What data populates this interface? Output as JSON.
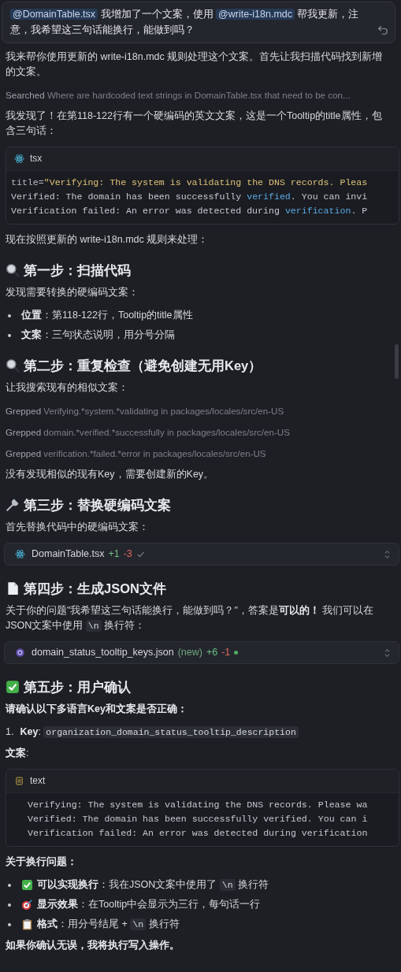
{
  "user_message": {
    "segments": [
      {
        "text": "@DomainTable.tsx",
        "kind": "mention"
      },
      {
        "text": " 我增加了一个文案，使用 ",
        "kind": "plain"
      },
      {
        "text": "@write-i18n.mdc",
        "kind": "mention"
      },
      {
        "text": " 帮我更新，注意，我希望这三句话能换行，能做到吗？",
        "kind": "plain"
      }
    ]
  },
  "blocks": [
    {
      "kind": "paragraph",
      "segments": [
        {
          "text": "我来帮你使用更新的 write-i18n.mdc 规则处理这个文案。首先让我扫描代码找到新增的文案。",
          "kind": "plain"
        }
      ]
    },
    {
      "kind": "tool",
      "verb": "Searched",
      "detail": "Where are hardcoded text strings in DomainTable.tsx that need to be con..."
    },
    {
      "kind": "paragraph",
      "segments": [
        {
          "text": "我发现了！在第118-122行有一个硬编码的英文文案，这是一个Tooltip的title属性，包含三句话：",
          "kind": "plain"
        }
      ]
    },
    {
      "kind": "code",
      "lang": "tsx",
      "lines": [
        [
          {
            "text": "title=",
            "kind": "attr"
          },
          {
            "text": "\"Verifying: The system is validating the DNS records. Pleas",
            "kind": "string"
          }
        ],
        [
          {
            "text": "Verified: The domain has been successfully ",
            "kind": "plain"
          },
          {
            "text": "verified",
            "kind": "link"
          },
          {
            "text": ". You can invi",
            "kind": "plain"
          }
        ],
        [
          {
            "text": "Verification failed: An error was detected during ",
            "kind": "plain"
          },
          {
            "text": "verification",
            "kind": "link"
          },
          {
            "text": ". P",
            "kind": "plain"
          }
        ]
      ]
    },
    {
      "kind": "paragraph",
      "segments": [
        {
          "text": "现在按照更新的 write-i18n.mdc 规则来处理：",
          "kind": "plain"
        }
      ]
    },
    {
      "kind": "heading",
      "text": "第一步：扫描代码"
    },
    {
      "kind": "paragraph",
      "segments": [
        {
          "text": "发现需要转换的硬编码文案：",
          "kind": "plain"
        }
      ]
    },
    {
      "kind": "list",
      "items": [
        {
          "kind": "plain",
          "segments": [
            {
              "text": "位置",
              "kind": "bold"
            },
            {
              "text": "：第118-122行，Tooltip的title属性",
              "kind": "plain"
            }
          ]
        },
        {
          "kind": "plain",
          "segments": [
            {
              "text": "文案",
              "kind": "bold"
            },
            {
              "text": "：三句状态说明，用分号分隔",
              "kind": "plain"
            }
          ]
        }
      ]
    },
    {
      "kind": "heading",
      "text": "第二步：重复检查（避免创建无用Key）"
    },
    {
      "kind": "paragraph",
      "segments": [
        {
          "text": "让我搜索现有的相似文案：",
          "kind": "plain"
        }
      ]
    },
    {
      "kind": "tool",
      "verb": "Grepped",
      "detail": "Verifying.*system.*validating in packages/locales/src/en-US"
    },
    {
      "kind": "tool",
      "verb": "Grepped",
      "detail": "domain.*verified.*successfully in packages/locales/src/en-US"
    },
    {
      "kind": "tool",
      "verb": "Grepped",
      "detail": "verification.*failed.*error in packages/locales/src/en-US"
    },
    {
      "kind": "paragraph",
      "segments": [
        {
          "text": "没有发现相似的现有Key，需要创建新的Key。",
          "kind": "plain"
        }
      ]
    },
    {
      "kind": "heading",
      "text": "第三步：替换硬编码文案"
    },
    {
      "kind": "paragraph",
      "segments": [
        {
          "text": "首先替换代码中的硬编码文案：",
          "kind": "plain"
        }
      ]
    },
    {
      "kind": "file",
      "name": "DomainTable.tsx",
      "added": "+1",
      "removed": "-3",
      "accepted": true
    },
    {
      "kind": "heading",
      "text": "第四步：生成JSON文件"
    },
    {
      "kind": "paragraph",
      "segments": [
        {
          "text": "关于你的问题\"我希望这三句话能换行，能做到吗？\"，答案是",
          "kind": "plain"
        },
        {
          "text": "可以的！",
          "kind": "bold"
        },
        {
          "text": " 我们可以在JSON文案中使用 ",
          "kind": "plain"
        },
        {
          "text": "\\n",
          "kind": "code"
        },
        {
          "text": " 换行符：",
          "kind": "plain"
        }
      ]
    },
    {
      "kind": "file",
      "name": "domain_status_tooltip_keys.json",
      "note": "(new)",
      "added": "+6",
      "removed": "-1",
      "accepted": false
    },
    {
      "kind": "heading",
      "text": "第五步：用户确认"
    },
    {
      "kind": "paragraph",
      "segments": [
        {
          "text": "请确认以下多语言Key和文案是否正确：",
          "kind": "bold"
        }
      ]
    },
    {
      "kind": "ordered",
      "items": [
        {
          "number": "1.",
          "segments": [
            {
              "text": "Key",
              "kind": "bold"
            },
            {
              "text": ": ",
              "kind": "plain"
            },
            {
              "text": "organization_domain_status_tooltip_description",
              "kind": "code"
            }
          ]
        }
      ]
    },
    {
      "kind": "paragraph",
      "segments": [
        {
          "text": "文案",
          "kind": "bold"
        },
        {
          "text": ":",
          "kind": "plain"
        }
      ]
    },
    {
      "kind": "code",
      "lang": "text",
      "lines": [
        [
          {
            "text": "Verifying: The system is validating the DNS records. Please wa",
            "kind": "plain"
          }
        ],
        [
          {
            "text": "Verified: The domain has been successfully verified. You can i",
            "kind": "plain"
          }
        ],
        [
          {
            "text": "Verification failed: An error was detected during verification",
            "kind": "plain"
          }
        ]
      ]
    },
    {
      "kind": "paragraph",
      "segments": [
        {
          "text": "关于换行问题：",
          "kind": "bold"
        }
      ]
    },
    {
      "kind": "list",
      "items": [
        {
          "kind": "check",
          "segments": [
            {
              "text": "可以实现换行",
              "kind": "bold"
            },
            {
              "text": "：我在JSON文案中使用了 ",
              "kind": "plain"
            },
            {
              "text": "\\n",
              "kind": "code"
            },
            {
              "text": " 换行符",
              "kind": "plain"
            }
          ]
        },
        {
          "kind": "target",
          "segments": [
            {
              "text": "显示效果",
              "kind": "bold"
            },
            {
              "text": "：在Tooltip中会显示为三行，每句话一行",
              "kind": "plain"
            }
          ]
        },
        {
          "kind": "clipboard",
          "segments": [
            {
              "text": "格式",
              "kind": "bold"
            },
            {
              "text": "：用分号结尾 + ",
              "kind": "plain"
            },
            {
              "text": "\\n",
              "kind": "code"
            },
            {
              "text": " 换行符",
              "kind": "plain"
            }
          ]
        }
      ]
    },
    {
      "kind": "paragraph",
      "segments": [
        {
          "text": "如果你确认无误，我将执行写入操作。",
          "kind": "bold"
        }
      ]
    }
  ]
}
